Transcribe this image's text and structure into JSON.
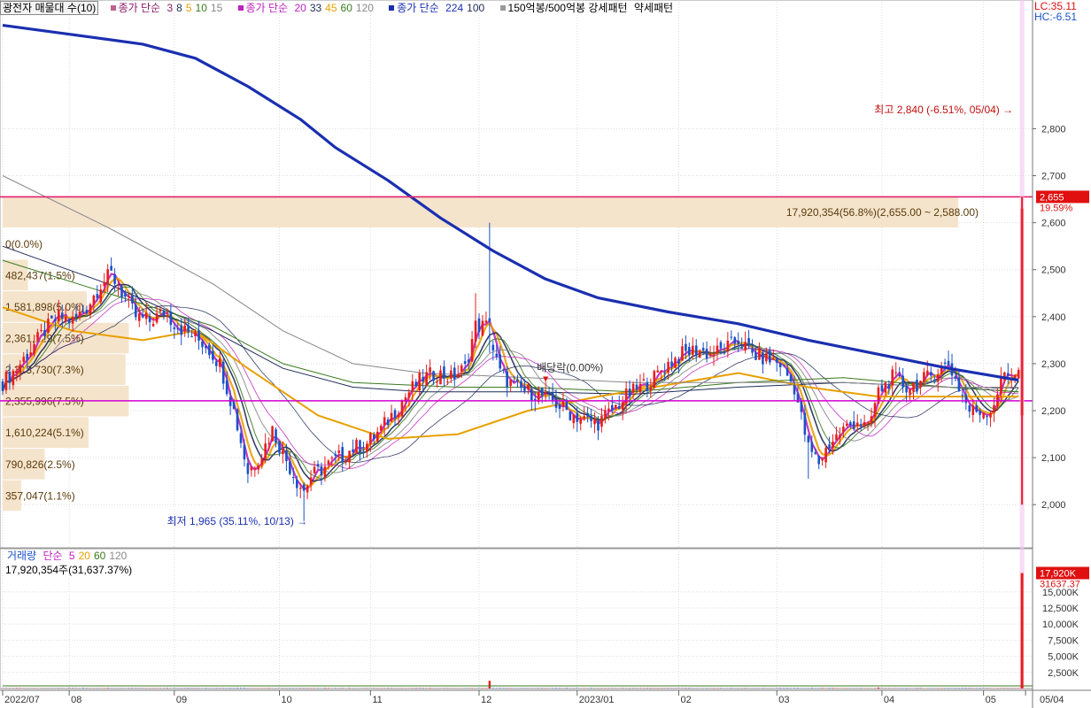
{
  "legend": {
    "title": "광전자 매물대 수(10)",
    "ma_short_label": "종가 단순",
    "ma_short": [
      {
        "v": "3",
        "c": "#8b1a6a"
      },
      {
        "v": "8",
        "c": "#1f2b5a"
      },
      {
        "v": "5",
        "c": "#e8a000"
      },
      {
        "v": "10",
        "c": "#3a7a1e"
      },
      {
        "v": "15",
        "c": "#888888"
      }
    ],
    "ma_mid_label": "종가 단순",
    "ma_mid": [
      {
        "v": "20",
        "c": "#c020c0"
      },
      {
        "v": "33",
        "c": "#1f2b5a"
      },
      {
        "v": "45",
        "c": "#e8a000"
      },
      {
        "v": "60",
        "c": "#3a7a1e"
      },
      {
        "v": "120",
        "c": "#888888"
      }
    ],
    "ma_long_label": "종가 단순",
    "ma_long": [
      {
        "v": "224",
        "c": "#1a2fb0"
      },
      {
        "v": "100",
        "c": "#1f2b5a"
      }
    ],
    "pattern": "150억봉/500억봉 강세패턴",
    "pattern_weak": "약세패턴"
  },
  "corner": {
    "lc": "LC:35.11",
    "hc": "HC:-6.51"
  },
  "volume_legend": {
    "title": "거래량",
    "label": "단순",
    "periods": [
      {
        "v": "5",
        "c": "#c020c0"
      },
      {
        "v": "20",
        "c": "#e8a000"
      },
      {
        "v": "60",
        "c": "#3a7a1e"
      },
      {
        "v": "120",
        "c": "#888888"
      }
    ],
    "summary": "17,920,354주(31,637.37%)"
  },
  "colors": {
    "up": "#e81e1e",
    "down": "#1a52c8",
    "ma224": "#1a2fb0",
    "hline": "#e0206e",
    "support": "#d000d0",
    "profile": "#f5e4cc",
    "grid": "#dddddd",
    "axis_bg": "#ffffff"
  },
  "chart_data": {
    "type": "candlestick",
    "price_axis": {
      "min": 1910,
      "max": 3040,
      "ticks": [
        "2,000",
        "2,100",
        "2,200",
        "2,300",
        "2,400",
        "2,500",
        "2,600",
        "2,700",
        "2,800"
      ]
    },
    "volume_axis": {
      "min": 0,
      "max": 19500,
      "unit": "K",
      "ticks": [
        "2,500K",
        "5,000K",
        "7,500K",
        "10,000K",
        "12,500K",
        "15,000K"
      ]
    },
    "x_labels": [
      {
        "label": "2022/07",
        "d": 0
      },
      {
        "label": "08",
        "d": 19
      },
      {
        "label": "09",
        "d": 49
      },
      {
        "label": "10",
        "d": 79
      },
      {
        "label": "11",
        "d": 105
      },
      {
        "label": "12",
        "d": 136
      },
      {
        "label": "2023/01",
        "d": 164
      },
      {
        "label": "02",
        "d": 193
      },
      {
        "label": "03",
        "d": 221
      },
      {
        "label": "04",
        "d": 251
      },
      {
        "label": "05",
        "d": 280
      },
      {
        "label": "05/04",
        "d": 292
      }
    ],
    "price_path": [
      [
        0,
        2260
      ],
      [
        4,
        2290
      ],
      [
        8,
        2330
      ],
      [
        12,
        2370
      ],
      [
        16,
        2400
      ],
      [
        20,
        2390
      ],
      [
        24,
        2420
      ],
      [
        28,
        2470
      ],
      [
        31,
        2490
      ],
      [
        35,
        2440
      ],
      [
        38,
        2400
      ],
      [
        42,
        2390
      ],
      [
        46,
        2410
      ],
      [
        50,
        2380
      ],
      [
        54,
        2360
      ],
      [
        58,
        2340
      ],
      [
        62,
        2300
      ],
      [
        66,
        2200
      ],
      [
        70,
        2070
      ],
      [
        74,
        2110
      ],
      [
        77,
        2160
      ],
      [
        80,
        2110
      ],
      [
        84,
        2050
      ],
      [
        86,
        2030
      ],
      [
        88,
        2060
      ],
      [
        92,
        2080
      ],
      [
        96,
        2100
      ],
      [
        100,
        2120
      ],
      [
        104,
        2130
      ],
      [
        108,
        2160
      ],
      [
        112,
        2200
      ],
      [
        116,
        2240
      ],
      [
        120,
        2270
      ],
      [
        124,
        2280
      ],
      [
        128,
        2270
      ],
      [
        132,
        2290
      ],
      [
        135,
        2380
      ],
      [
        138,
        2380
      ],
      [
        142,
        2280
      ],
      [
        146,
        2250
      ],
      [
        150,
        2240
      ],
      [
        154,
        2230
      ],
      [
        158,
        2215
      ],
      [
        162,
        2195
      ],
      [
        166,
        2180
      ],
      [
        170,
        2175
      ],
      [
        174,
        2200
      ],
      [
        178,
        2230
      ],
      [
        182,
        2250
      ],
      [
        186,
        2270
      ],
      [
        190,
        2300
      ],
      [
        194,
        2320
      ],
      [
        198,
        2330
      ],
      [
        202,
        2320
      ],
      [
        206,
        2330
      ],
      [
        210,
        2350
      ],
      [
        214,
        2320
      ],
      [
        218,
        2310
      ],
      [
        222,
        2300
      ],
      [
        226,
        2250
      ],
      [
        230,
        2120
      ],
      [
        233,
        2090
      ],
      [
        236,
        2130
      ],
      [
        240,
        2160
      ],
      [
        244,
        2180
      ],
      [
        247,
        2160
      ],
      [
        250,
        2240
      ],
      [
        254,
        2270
      ],
      [
        258,
        2250
      ],
      [
        262,
        2260
      ],
      [
        266,
        2280
      ],
      [
        270,
        2300
      ],
      [
        273,
        2250
      ],
      [
        276,
        2200
      ],
      [
        279,
        2200
      ],
      [
        282,
        2200
      ],
      [
        286,
        2280
      ]
    ],
    "ma224": [
      [
        0,
        3020
      ],
      [
        20,
        3000
      ],
      [
        40,
        2980
      ],
      [
        55,
        2950
      ],
      [
        70,
        2890
      ],
      [
        85,
        2820
      ],
      [
        95,
        2760
      ],
      [
        110,
        2690
      ],
      [
        125,
        2610
      ],
      [
        140,
        2540
      ],
      [
        155,
        2480
      ],
      [
        170,
        2440
      ],
      [
        190,
        2410
      ],
      [
        210,
        2385
      ],
      [
        230,
        2350
      ],
      [
        250,
        2320
      ],
      [
        270,
        2290
      ],
      [
        290,
        2265
      ]
    ],
    "ma_mid_lines": [
      {
        "c": "#1f2b5a",
        "pts": [
          [
            0,
            2550
          ],
          [
            30,
            2470
          ],
          [
            60,
            2370
          ],
          [
            80,
            2290
          ],
          [
            100,
            2250
          ],
          [
            120,
            2240
          ],
          [
            150,
            2240
          ],
          [
            180,
            2235
          ],
          [
            210,
            2250
          ],
          [
            240,
            2260
          ],
          [
            270,
            2250
          ],
          [
            290,
            2240
          ]
        ]
      },
      {
        "c": "#e8a000",
        "pts": [
          [
            0,
            2420
          ],
          [
            20,
            2370
          ],
          [
            40,
            2350
          ],
          [
            55,
            2370
          ],
          [
            70,
            2290
          ],
          [
            90,
            2190
          ],
          [
            110,
            2140
          ],
          [
            130,
            2150
          ],
          [
            150,
            2200
          ],
          [
            170,
            2230
          ],
          [
            190,
            2255
          ],
          [
            210,
            2280
          ],
          [
            230,
            2250
          ],
          [
            250,
            2230
          ],
          [
            270,
            2230
          ],
          [
            290,
            2230
          ]
        ]
      },
      {
        "c": "#3a7a1e",
        "pts": [
          [
            0,
            2520
          ],
          [
            30,
            2450
          ],
          [
            60,
            2380
          ],
          [
            80,
            2300
          ],
          [
            100,
            2260
          ],
          [
            130,
            2250
          ],
          [
            150,
            2250
          ],
          [
            180,
            2240
          ],
          [
            210,
            2260
          ],
          [
            240,
            2270
          ],
          [
            270,
            2250
          ],
          [
            290,
            2240
          ]
        ]
      },
      {
        "c": "#888888",
        "pts": [
          [
            0,
            2700
          ],
          [
            30,
            2590
          ],
          [
            60,
            2470
          ],
          [
            80,
            2370
          ],
          [
            100,
            2300
          ],
          [
            120,
            2280
          ],
          [
            150,
            2270
          ],
          [
            180,
            2260
          ],
          [
            210,
            2260
          ],
          [
            240,
            2260
          ],
          [
            270,
            2250
          ],
          [
            290,
            2250
          ]
        ]
      }
    ],
    "volume_profile": [
      {
        "low": 2588,
        "high": 2655,
        "label": "17,920,354(56.8%)(2,655.00 ~ 2,588.00)",
        "frac": 0.568
      },
      {
        "low": 2521,
        "high": 2588,
        "label": "0(0.0%)",
        "frac": 0.0
      },
      {
        "low": 2454,
        "high": 2521,
        "label": "482,437(1.5%)",
        "frac": 0.015
      },
      {
        "low": 2387,
        "high": 2454,
        "label": "1,581,898(5.0%)",
        "frac": 0.05
      },
      {
        "low": 2320,
        "high": 2387,
        "label": "2,361,129(7.5%)",
        "frac": 0.075
      },
      {
        "low": 2253,
        "high": 2320,
        "label": "2,313,730(7.3%)",
        "frac": 0.073
      },
      {
        "low": 2186,
        "high": 2253,
        "label": "2,355,996(7.5%)",
        "frac": 0.075
      },
      {
        "low": 2119,
        "high": 2186,
        "label": "1,610,224(5.1%)",
        "frac": 0.051
      },
      {
        "low": 2052,
        "high": 2119,
        "label": "790,826(2.5%)",
        "frac": 0.025
      },
      {
        "low": 1985,
        "high": 2052,
        "label": "357,047(1.1%)",
        "frac": 0.011
      }
    ],
    "hlines": [
      {
        "value": 2655,
        "label": "2,655",
        "pct": "19.59%"
      },
      {
        "value": 2221
      }
    ],
    "support_band": 2221,
    "annotations": {
      "high": {
        "text": "최고 2,840 (-6.51%, 05/04)",
        "value": 2840,
        "d": 291
      },
      "low": {
        "text": "최저 1,965 (35.11%, 10/13)",
        "value": 1965,
        "d": 86
      },
      "dividend": {
        "text": "배당락(0.00%)",
        "value": 2250,
        "d": 155
      }
    },
    "last": {
      "d": 291,
      "open": 2190,
      "close": 2630,
      "high": 2840,
      "low": 2170
    },
    "volume_last": {
      "value": 17920,
      "label": "17,920K",
      "pct": "31637.37"
    },
    "volume_spikes": [
      {
        "d": 139,
        "value": 1200
      },
      {
        "d": 250,
        "value": 150
      },
      {
        "d": 30,
        "value": 80
      }
    ]
  }
}
